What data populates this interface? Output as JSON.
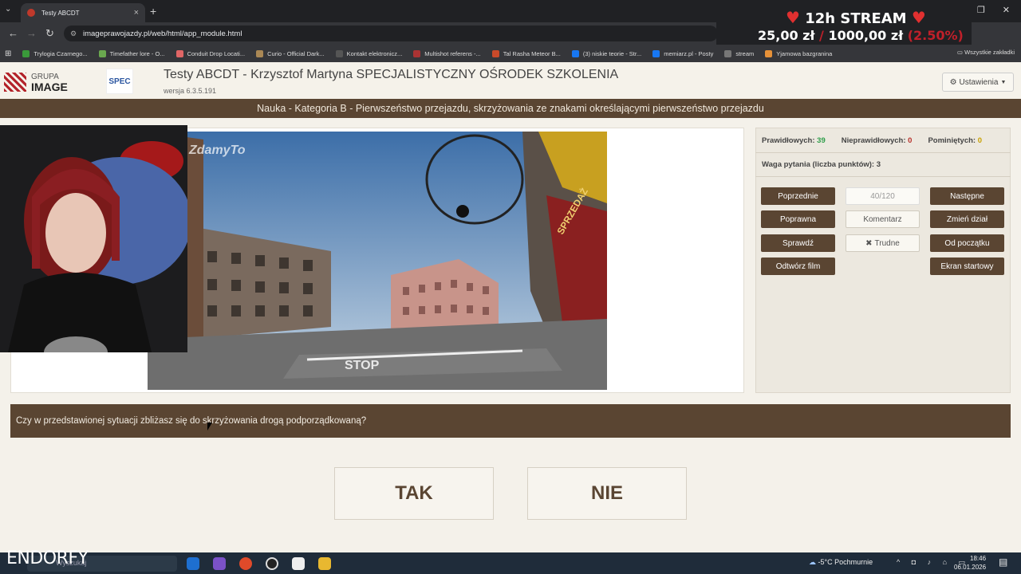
{
  "browser": {
    "tab_title": "Testy ABCDT",
    "url": "imageprawojazdy.pl/web/html/app_module.html",
    "bookmarks": [
      "Trylogia Czarnego...",
      "Timefather lore - O...",
      "Conduit Drop Locati...",
      "Curio - Official Dark...",
      "Kontakt elektronicz...",
      "Multishot referens -...",
      "Tal Rasha Meteor B...",
      "(3) niskie teorie - Str...",
      "memiarz.pl - Posty",
      "stream",
      "Yjamowa bazgranina"
    ],
    "all_bookmarks": "Wszystkie zakładki"
  },
  "stream": {
    "title": "12h STREAM",
    "raised": "25,00 zł",
    "separator": "/",
    "goal": "1000,00 zł",
    "percent": "(2.50%)",
    "progress_fraction": 0.025
  },
  "app": {
    "logo_top": "GRUPA",
    "logo_bottom": "IMAGE",
    "logo2": "SPEC",
    "title": "Testy ABCDT - Krzysztof Martyna SPECJALISTYCZNY OŚRODEK SZKOLENIA",
    "version": "wersja 6.3.5.191",
    "settings": "Ustawienia",
    "category": "Nauka - Kategoria B - Pierwszeństwo przejazdu, skrzyżowania ze znakami określającymi pierwszeństwo przejazdu"
  },
  "media": {
    "watermark": "ZdamyTo",
    "road_text": "STOP",
    "shop_text": "SPRZEDAŻ"
  },
  "stats": {
    "correct_label": "Prawidłowych:",
    "correct": "39",
    "incorrect_label": "Nieprawidłowych:",
    "incorrect": "0",
    "skipped_label": "Pominiętych:",
    "skipped": "0",
    "weight_label": "Waga pytania (liczba punktów):",
    "weight": "3"
  },
  "buttons": {
    "prev": "Poprzednie",
    "counter": "40/120",
    "next": "Następne",
    "correct": "Poprawna",
    "comment": "Komentarz",
    "change": "Zmień dział",
    "check": "Sprawdź",
    "hard": "Trudne",
    "restart": "Od początku",
    "play": "Odtwórz film",
    "start": "Ekran startowy"
  },
  "question": "Czy w przedstawionej sytuacji zbliżasz się do skrzyżowania drogą podporządkowaną?",
  "answers": {
    "yes": "TAK",
    "no": "NIE"
  },
  "taskbar": {
    "brand": "ENDORFY",
    "search": "Wyszukaj",
    "weather": "-5°C  Pochmurnie",
    "time": "18:46",
    "date": "06.01.2026"
  }
}
